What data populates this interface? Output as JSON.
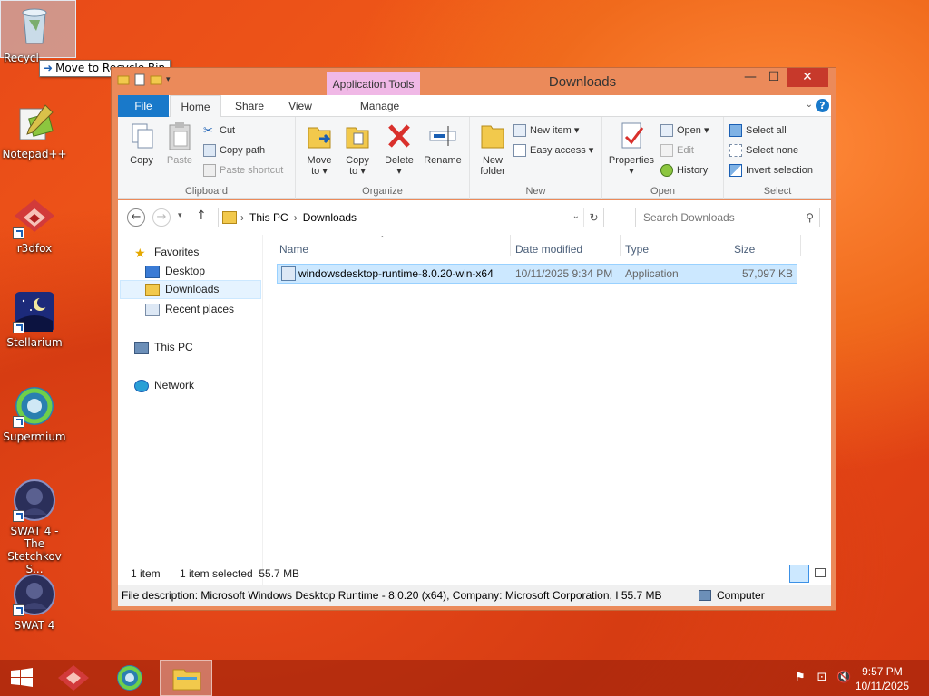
{
  "desktop": {
    "icons": [
      {
        "label": "Recycle Bin"
      },
      {
        "label": "Notepad++"
      },
      {
        "label": "r3dfox"
      },
      {
        "label": "Stellarium"
      },
      {
        "label": "Supermium"
      },
      {
        "label": "SWAT 4 - The Stetchkov S..."
      },
      {
        "label": "SWAT 4"
      }
    ],
    "drag_tooltip": "Move to Recycle Bin"
  },
  "window": {
    "title": "Downloads",
    "contextual_tab": "Application Tools",
    "close_symbol": "✕",
    "minimize_symbol": "—",
    "maximize_symbol": "☐",
    "help_symbol": "?",
    "tabs": [
      "File",
      "Home",
      "Share",
      "View",
      "Manage"
    ],
    "ribbon": {
      "clipboard": {
        "label": "Clipboard",
        "copy": "Copy",
        "paste": "Paste",
        "cut": "Cut",
        "copy_path": "Copy path",
        "paste_shortcut": "Paste shortcut"
      },
      "organize": {
        "label": "Organize",
        "move_to": "Move",
        "move_to2": "to ▾",
        "copy_to": "Copy",
        "copy_to2": "to ▾",
        "delete": "Delete",
        "delete2": "▾",
        "rename": "Rename"
      },
      "new": {
        "label": "New",
        "new_folder": "New",
        "new_folder2": "folder",
        "new_item": "New item ▾",
        "easy_access": "Easy access ▾"
      },
      "open": {
        "label": "Open",
        "properties": "Properties",
        "properties2": "▾",
        "open": "Open ▾",
        "edit": "Edit",
        "history": "History"
      },
      "select": {
        "label": "Select",
        "select_all": "Select all",
        "select_none": "Select none",
        "invert_selection": "Invert selection"
      }
    },
    "address": {
      "segments": [
        "This PC",
        "Downloads"
      ],
      "separator": "›"
    },
    "search_placeholder": "Search Downloads",
    "nav": {
      "favorites": "Favorites",
      "desktop": "Desktop",
      "downloads": "Downloads",
      "recent": "Recent places",
      "this_pc": "This PC",
      "network": "Network"
    },
    "columns": [
      "Name",
      "Date modified",
      "Type",
      "Size"
    ],
    "files": [
      {
        "name": "windowsdesktop-runtime-8.0.20-win-x64",
        "date": "10/11/2025 9:34 PM",
        "type": "Application",
        "size": "57,097 KB"
      }
    ],
    "status": {
      "count": "1 item",
      "selected": "1 item selected  55.7 MB"
    },
    "details": {
      "description": "File description: Microsoft Windows Desktop Runtime - 8.0.20 (x64), Company: Microsoft Corporation, I 55.7 MB",
      "location": "Computer"
    }
  },
  "taskbar": {
    "time": "9:57 PM",
    "date": "10/11/2025"
  }
}
